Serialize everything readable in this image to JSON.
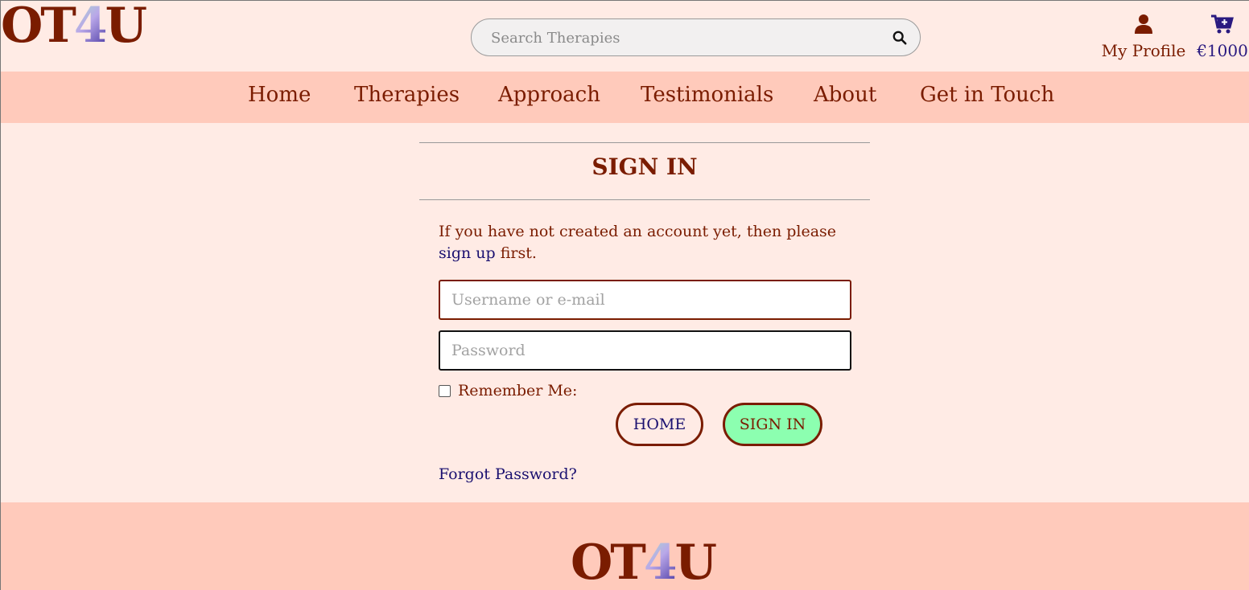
{
  "header": {
    "logo": {
      "part1": "OT",
      "part2": "4",
      "part3": "U"
    },
    "search": {
      "placeholder": "Search Therapies",
      "value": ""
    },
    "profile_label": "My Profile",
    "bag_total": "€1000"
  },
  "nav": [
    "Home",
    "Therapies",
    "Approach",
    "Testimonials",
    "About",
    "Get in Touch"
  ],
  "signin": {
    "title": "SIGN IN",
    "intro_before": "If you have not created an account yet, then please",
    "intro_link": "sign up",
    "intro_after": " first.",
    "username_placeholder": "Username or e-mail",
    "password_placeholder": "Password",
    "remember_label": "Remember Me:",
    "home_button": "HOME",
    "signin_button": "SIGN IN",
    "forgot_link": "Forgot Password?"
  },
  "footer": {
    "logo": {
      "part1": "OT",
      "part2": "4",
      "part3": "U"
    }
  },
  "colors": {
    "background": "#ffebe5",
    "nav_background": "#ffcabb",
    "text": "#7a1c00",
    "link": "#1a1070",
    "signin_button": "#8cffb0"
  },
  "icons": {
    "search": "search-icon",
    "profile": "user-icon",
    "bag": "shopping-cart-icon"
  }
}
